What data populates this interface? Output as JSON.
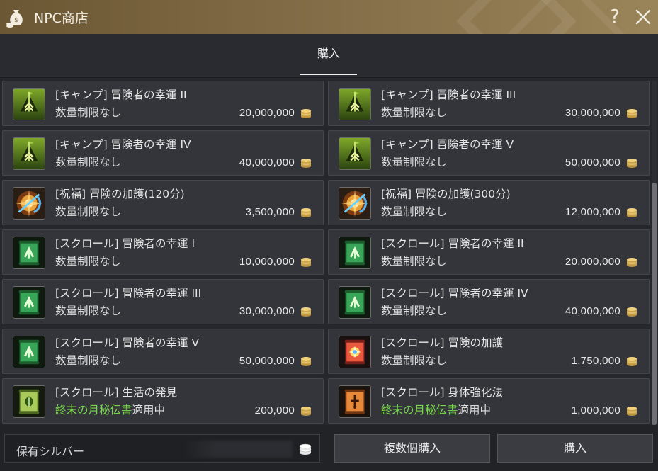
{
  "window": {
    "title": "NPC商店",
    "help_label": "?"
  },
  "tabs": [
    {
      "label": "購入",
      "active": true
    }
  ],
  "items": [
    {
      "name": "[キャンプ] 冒険者の幸運 II",
      "limit": "数量制限なし",
      "price": "20,000,000",
      "icon": "camp-tent-icon"
    },
    {
      "name": "[キャンプ] 冒険者の幸運 III",
      "limit": "数量制限なし",
      "price": "30,000,000",
      "icon": "camp-tent-icon"
    },
    {
      "name": "[キャンプ] 冒険者の幸運 IV",
      "limit": "数量制限なし",
      "price": "40,000,000",
      "icon": "camp-tent-icon"
    },
    {
      "name": "[キャンプ] 冒険者の幸運 V",
      "limit": "数量制限なし",
      "price": "50,000,000",
      "icon": "camp-tent-icon"
    },
    {
      "name": "[祝福] 冒険の加護(120分)",
      "limit": "数量制限なし",
      "price": "3,500,000",
      "icon": "blessing-burst-icon"
    },
    {
      "name": "[祝福] 冒険の加護(300分)",
      "limit": "数量制限なし",
      "price": "12,000,000",
      "icon": "blessing-burst-icon"
    },
    {
      "name": "[スクロール] 冒険者の幸運 I",
      "limit": "数量制限なし",
      "price": "10,000,000",
      "icon": "green-scroll-icon"
    },
    {
      "name": "[スクロール] 冒険者の幸運 II",
      "limit": "数量制限なし",
      "price": "20,000,000",
      "icon": "green-scroll-icon"
    },
    {
      "name": "[スクロール] 冒険者の幸運 III",
      "limit": "数量制限なし",
      "price": "30,000,000",
      "icon": "green-scroll-icon"
    },
    {
      "name": "[スクロール] 冒険者の幸運 IV",
      "limit": "数量制限なし",
      "price": "40,000,000",
      "icon": "green-scroll-icon"
    },
    {
      "name": "[スクロール] 冒険者の幸運 V",
      "limit": "数量制限なし",
      "price": "50,000,000",
      "icon": "green-scroll-icon"
    },
    {
      "name": "[スクロール] 冒険の加護",
      "limit": "数量制限なし",
      "price": "1,750,000",
      "icon": "red-scroll-icon"
    },
    {
      "name": "[スクロール] 生活の発見",
      "limit_highlight": "終末の月秘伝書",
      "limit_suffix": "適用中",
      "price": "200,000",
      "icon": "leaf-scroll-icon"
    },
    {
      "name": "[スクロール] 身体強化法",
      "limit_highlight": "終末の月秘伝書",
      "limit_suffix": "適用中",
      "price": "1,000,000",
      "icon": "orange-scroll-icon"
    }
  ],
  "footer": {
    "silver_label": "保有シルバー",
    "multi_buy_label": "複数個購入",
    "buy_label": "購入"
  },
  "colors": {
    "accent_gold": "#85704a",
    "highlight_green": "#78d84a",
    "coin_gold": "#d8b45a"
  }
}
